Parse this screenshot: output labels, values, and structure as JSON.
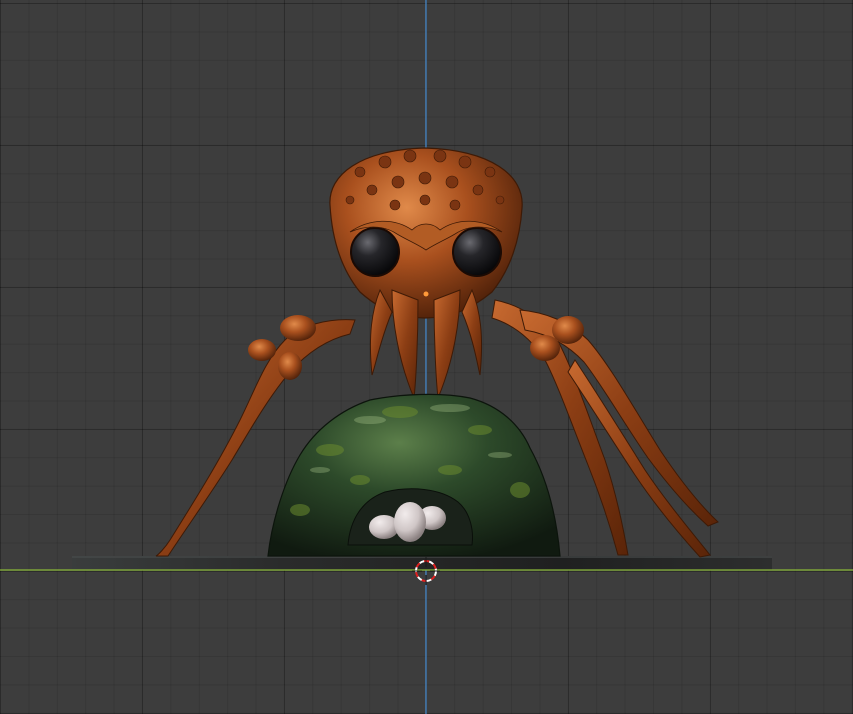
{
  "viewport": {
    "view": "front-orthographic",
    "grid": true,
    "colors": {
      "background": "#3d3d3d",
      "axis_x": "#8ab83a",
      "axis_z": "#4a8fd4",
      "cursor_red": "#e02020",
      "cursor_white": "#ffffff"
    }
  },
  "objects": [
    {
      "name": "spider",
      "material": "copper-bronze",
      "color": "#a9501e"
    },
    {
      "name": "egg-nest",
      "material": "mossy-green",
      "color": "#2d4a2a"
    },
    {
      "name": "eggs",
      "count": 3,
      "color": "#cfc6c6"
    },
    {
      "name": "ground-plane",
      "color": "#2a2a2a"
    }
  ],
  "icons": {
    "3d_cursor": "3d-cursor-icon"
  }
}
